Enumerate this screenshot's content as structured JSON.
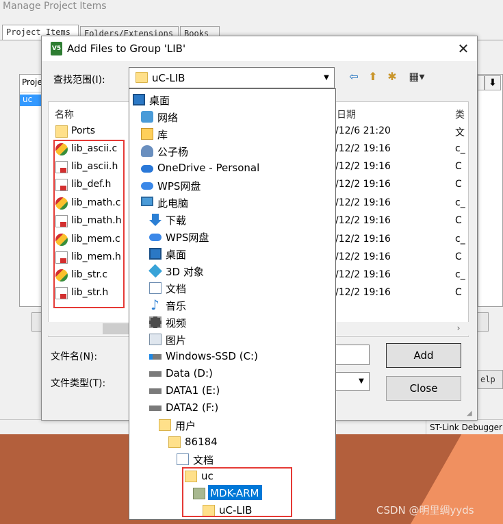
{
  "background": {
    "window_title": "Manage Project Items",
    "tabs": [
      "Project Items",
      "Folders/Extensions",
      "Books"
    ],
    "list_header": "Projec",
    "list_selected": "uc",
    "help_label": "elp",
    "status_text": "ST-Link Debugger",
    "watermark": "CSDN @明里绸yyds",
    "colors": {
      "accent_orange": "#b35f3c",
      "light_orange": "#f09060"
    }
  },
  "dialog": {
    "title": "Add Files to Group 'LIB'",
    "close_icon": "close-icon",
    "look_in_label": "查找范围(I):",
    "look_in_value": "uC-LIB",
    "toolbar_icons": [
      "back-arrow-icon",
      "up-folder-icon",
      "new-folder-icon",
      "view-menu-icon"
    ],
    "columns": {
      "name": "名称",
      "date": "日期",
      "type": "类"
    },
    "files": [
      {
        "name": "Ports",
        "icon": "folder-icon",
        "date": "/12/6 21:20",
        "type": "文"
      },
      {
        "name": "lib_ascii.c",
        "icon": "c-file-icon",
        "date": "/12/2 19:16",
        "type": "c_"
      },
      {
        "name": "lib_ascii.h",
        "icon": "h-file-icon",
        "date": "/12/2 19:16",
        "type": "C"
      },
      {
        "name": "lib_def.h",
        "icon": "h-file-icon",
        "date": "/12/2 19:16",
        "type": "C"
      },
      {
        "name": "lib_math.c",
        "icon": "c-file-icon",
        "date": "/12/2 19:16",
        "type": "c_"
      },
      {
        "name": "lib_math.h",
        "icon": "h-file-icon",
        "date": "/12/2 19:16",
        "type": "C"
      },
      {
        "name": "lib_mem.c",
        "icon": "c-file-icon",
        "date": "/12/2 19:16",
        "type": "c_"
      },
      {
        "name": "lib_mem.h",
        "icon": "h-file-icon",
        "date": "/12/2 19:16",
        "type": "C"
      },
      {
        "name": "lib_str.c",
        "icon": "c-file-icon",
        "date": "/12/2 19:16",
        "type": "c_"
      },
      {
        "name": "lib_str.h",
        "icon": "h-file-icon",
        "date": "/12/2 19:16",
        "type": "C"
      }
    ],
    "file_name_label": "文件名(N):",
    "file_type_label": "文件类型(T):",
    "add_button": "Add",
    "close_button": "Close"
  },
  "dropdown": {
    "items": [
      {
        "label": "桌面",
        "icon": "desktop-icon"
      },
      {
        "label": "网络",
        "icon": "network-icon"
      },
      {
        "label": "库",
        "icon": "library-icon"
      },
      {
        "label": "公子杨",
        "icon": "user-icon"
      },
      {
        "label": "OneDrive - Personal",
        "icon": "onedrive-icon"
      },
      {
        "label": "WPS网盘",
        "icon": "wps-cloud-icon"
      },
      {
        "label": "此电脑",
        "icon": "computer-icon"
      },
      {
        "label": "下载",
        "icon": "download-icon"
      },
      {
        "label": "WPS网盘",
        "icon": "wps-cloud-icon"
      },
      {
        "label": "桌面",
        "icon": "desktop-icon"
      },
      {
        "label": "3D 对象",
        "icon": "3d-objects-icon"
      },
      {
        "label": "文档",
        "icon": "documents-icon"
      },
      {
        "label": "音乐",
        "icon": "music-icon"
      },
      {
        "label": "视频",
        "icon": "video-icon"
      },
      {
        "label": "图片",
        "icon": "pictures-icon"
      },
      {
        "label": "Windows-SSD (C:)",
        "icon": "windows-drive-icon"
      },
      {
        "label": "Data (D:)",
        "icon": "drive-icon"
      },
      {
        "label": "DATA1 (E:)",
        "icon": "drive-icon"
      },
      {
        "label": "DATA2 (F:)",
        "icon": "drive-icon"
      },
      {
        "label": "用户",
        "icon": "folder-icon"
      },
      {
        "label": "86184",
        "icon": "folder-icon"
      },
      {
        "label": "文档",
        "icon": "documents-icon"
      },
      {
        "label": "uc",
        "icon": "folder-icon"
      },
      {
        "label": "MDK-ARM",
        "icon": "project-folder-icon",
        "selected": true
      },
      {
        "label": "uC-LIB",
        "icon": "folder-icon"
      }
    ]
  }
}
